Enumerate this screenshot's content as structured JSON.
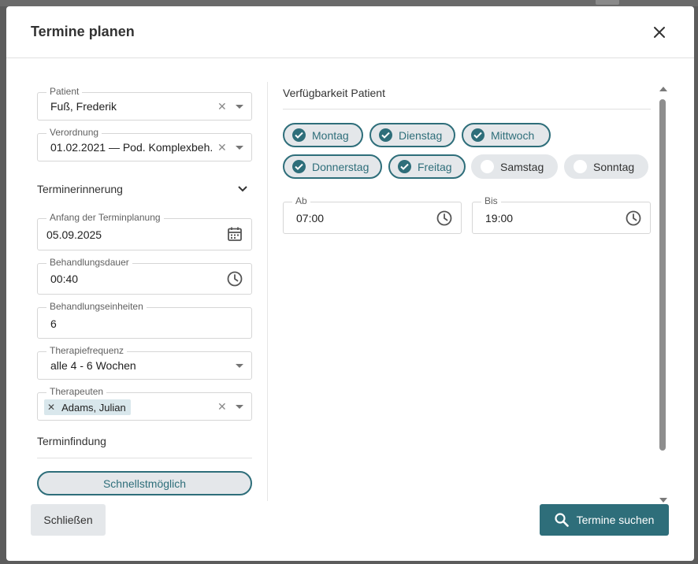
{
  "dialog": {
    "title": "Termine planen"
  },
  "left": {
    "patient": {
      "label": "Patient",
      "value": "Fuß, Frederik"
    },
    "verordnung": {
      "label": "Verordnung",
      "value": "01.02.2021 — Pod. Komplexbeh."
    },
    "reminder_section": "Terminerinnerung",
    "start": {
      "label": "Anfang der Terminplanung",
      "value": "05.09.2025"
    },
    "duration": {
      "label": "Behandlungsdauer",
      "value": "00:40"
    },
    "units": {
      "label": "Behandlungseinheiten",
      "value": "6"
    },
    "frequency": {
      "label": "Therapiefrequenz",
      "value": "alle 4 - 6 Wochen"
    },
    "therapists": {
      "label": "Therapeuten",
      "chips": [
        "Adams, Julian"
      ]
    },
    "finding_section": "Terminfindung",
    "finding_option": "Schnellstmöglich"
  },
  "right": {
    "title": "Verfügbarkeit Patient",
    "days": [
      {
        "label": "Montag",
        "checked": true
      },
      {
        "label": "Dienstag",
        "checked": true
      },
      {
        "label": "Mittwoch",
        "checked": true
      },
      {
        "label": "Donnerstag",
        "checked": true
      },
      {
        "label": "Freitag",
        "checked": true
      },
      {
        "label": "Samstag",
        "checked": false
      },
      {
        "label": "Sonntag",
        "checked": false
      }
    ],
    "from": {
      "label": "Ab",
      "value": "07:00"
    },
    "to": {
      "label": "Bis",
      "value": "19:00"
    }
  },
  "footer": {
    "close_label": "Schließen",
    "search_label": "Termine suchen"
  },
  "colors": {
    "accent": "#2e6e7a",
    "chip_bg": "#e4e7ea",
    "backdrop": "#5c5c5c"
  }
}
